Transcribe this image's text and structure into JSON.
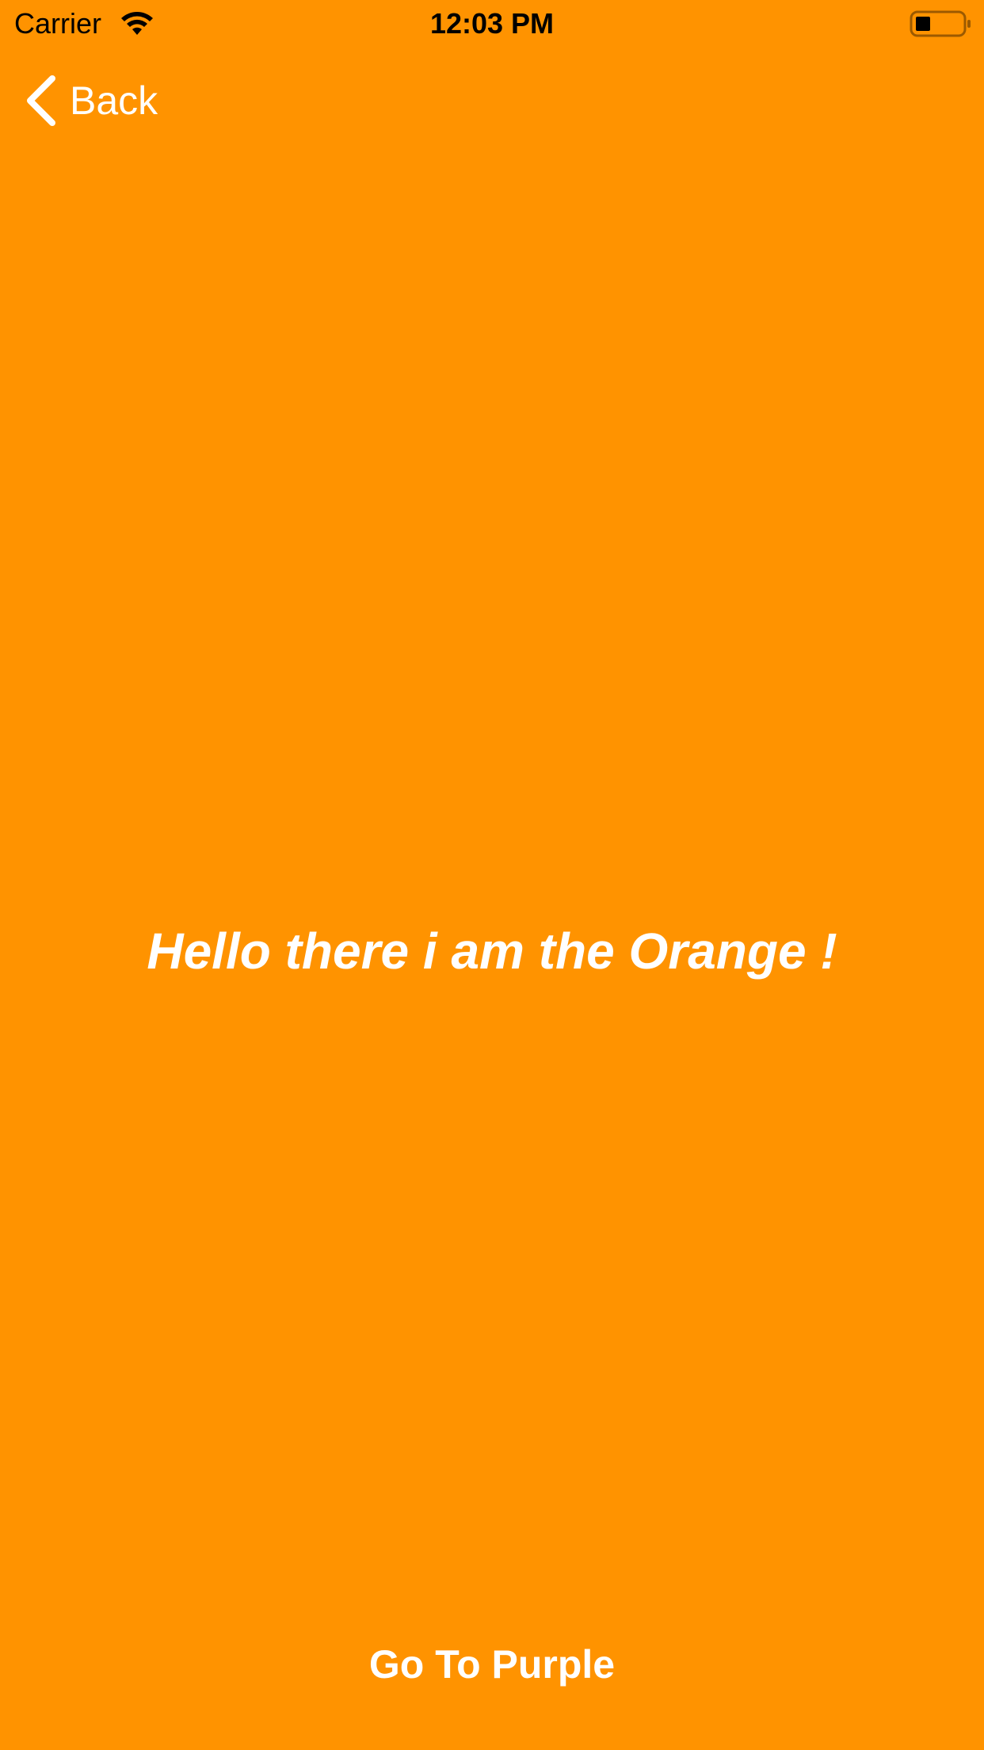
{
  "status_bar": {
    "carrier": "Carrier",
    "wifi_icon": "wifi-icon",
    "time": "12:03 PM",
    "battery_icon": "battery-icon"
  },
  "nav": {
    "back_label": "Back",
    "back_icon": "chevron-left-icon"
  },
  "main": {
    "greeting": "Hello there i am the Orange !",
    "button_label": "Go To Purple"
  },
  "colors": {
    "background": "#FF9300",
    "text": "#FFFFFF",
    "status_text": "#000000"
  }
}
